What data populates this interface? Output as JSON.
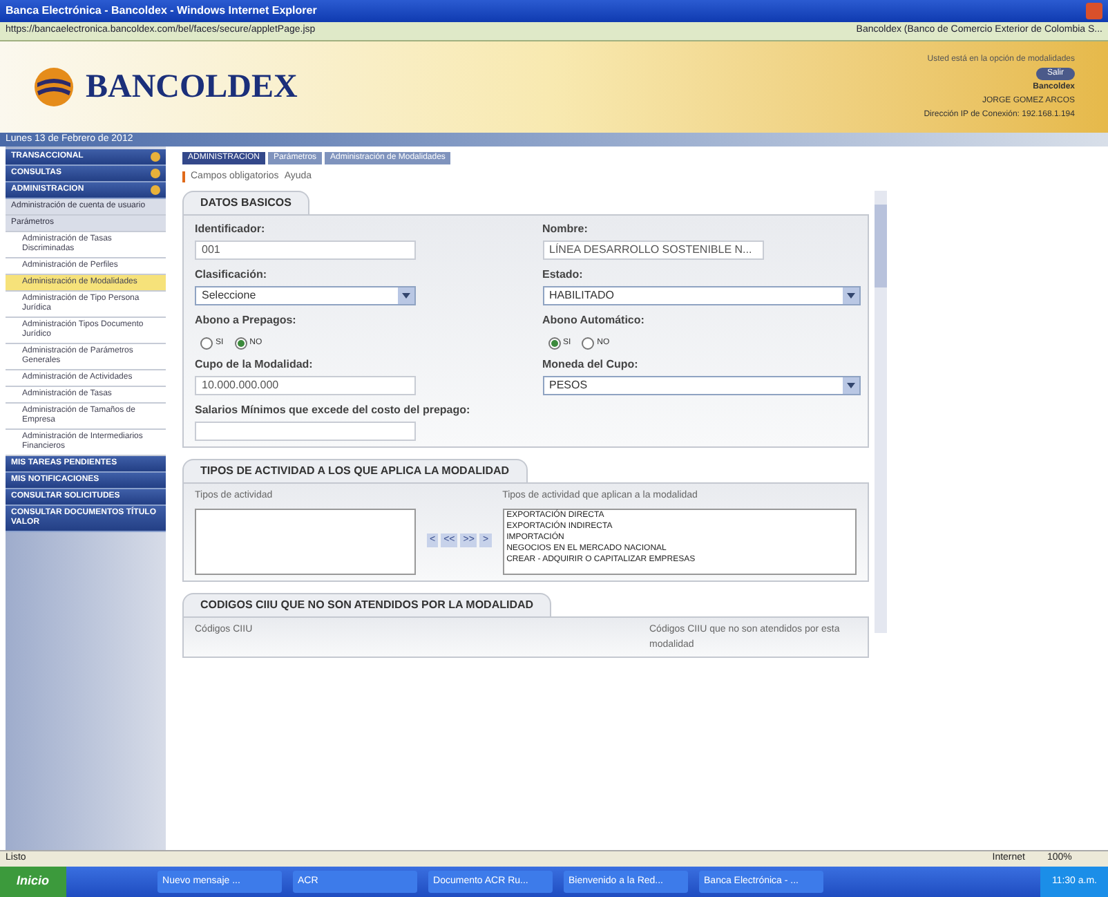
{
  "window": {
    "title": "Banca Electrónica - Bancoldex - Windows Internet Explorer"
  },
  "address_bar": {
    "url": "https://bancaelectronica.bancoldex.com/bel/faces/secure/appletPage.jsp",
    "tab": "Bancoldex (Banco de Comercio Exterior de Colombia S..."
  },
  "header": {
    "logo": "BANCOLDEX",
    "notice": "Usted está en la opción de modalidades",
    "logout": "Salir",
    "company": "Bancoldex",
    "user": "JORGE GOMEZ ARCOS",
    "ip": "Dirección IP de Conexión: 192.168.1.194",
    "date": "Lunes 13 de Febrero de 2012"
  },
  "sidebar": {
    "items": [
      {
        "label": "TRANSACCIONAL",
        "kind": "section"
      },
      {
        "label": "CONSULTAS",
        "kind": "section"
      },
      {
        "label": "ADMINISTRACION",
        "kind": "section",
        "children": [
          {
            "label": "Administración de cuenta de usuario",
            "kind": "group",
            "selected": false
          },
          {
            "label": "Parámetros",
            "kind": "group",
            "selected": false
          },
          {
            "label": "Administración de Tasas Discriminadas",
            "kind": "link",
            "selected": false
          },
          {
            "label": "Administración de Perfiles",
            "kind": "link",
            "selected": false
          },
          {
            "label": "Administración de Modalidades",
            "kind": "link",
            "selected": true
          },
          {
            "label": "Administración de Tipo Persona Jurídica",
            "kind": "link",
            "selected": false
          },
          {
            "label": "Administración Tipos Documento Jurídico",
            "kind": "link",
            "selected": false
          },
          {
            "label": "Administración de Parámetros Generales",
            "kind": "link",
            "selected": false
          },
          {
            "label": "Administración de Actividades",
            "kind": "link",
            "selected": false
          },
          {
            "label": "Administración de Tasas",
            "kind": "link",
            "selected": false
          },
          {
            "label": "Administración de Tamaños de Empresa",
            "kind": "link",
            "selected": false
          },
          {
            "label": "Administración de Intermediarios Financieros",
            "kind": "link",
            "selected": false
          }
        ]
      },
      {
        "label": "MIS TAREAS PENDIENTES",
        "kind": "plain"
      },
      {
        "label": "MIS NOTIFICACIONES",
        "kind": "plain"
      },
      {
        "label": "CONSULTAR SOLICITUDES",
        "kind": "plain"
      },
      {
        "label": "CONSULTAR DOCUMENTOS TÍTULO VALOR",
        "kind": "plain"
      }
    ]
  },
  "breadcrumb": [
    {
      "label": "ADMINISTRACION",
      "selected": true
    },
    {
      "label": "Parámetros",
      "selected": false
    },
    {
      "label": "Administración de Modalidades",
      "selected": false
    }
  ],
  "legend": {
    "required": "Campos obligatorios",
    "help": "Ayuda"
  },
  "basic": {
    "title": "DATOS BASICOS",
    "fields": [
      {
        "label": "Identificador:",
        "value": "001",
        "kind": "text"
      },
      {
        "label": "Nombre:",
        "value": "LÍNEA DESARROLLO SOSTENIBLE N...",
        "kind": "text"
      },
      {
        "label": "Clasificación:",
        "value": "Seleccione",
        "kind": "select"
      },
      {
        "label": "Estado:",
        "value": "HABILITADO",
        "kind": "select"
      },
      {
        "label": "Abono a Prepagos:",
        "kind": "radio",
        "options": [
          {
            "label": "SI",
            "selected": false
          },
          {
            "label": "NO",
            "selected": true
          }
        ]
      },
      {
        "label": "Abono Automático:",
        "kind": "radio",
        "options": [
          {
            "label": "SI",
            "selected": true
          },
          {
            "label": "NO",
            "selected": false
          }
        ]
      },
      {
        "label": "Cupo de la Modalidad:",
        "value": "10.000.000.000",
        "kind": "text"
      },
      {
        "label": "Moneda del Cupo:",
        "value": "PESOS",
        "kind": "select"
      },
      {
        "label": "Salarios Mínimos que excede del costo del prepago:",
        "kind": "text"
      }
    ]
  },
  "activities": {
    "title": "TIPOS DE ACTIVIDAD A LOS QUE APLICA LA MODALIDAD",
    "left_label": "Tipos de actividad",
    "right_label": "Tipos de actividad que aplican a la modalidad",
    "move_buttons": [
      "<",
      "<<",
      ">>",
      ">"
    ],
    "selected_items": [
      "EXPORTACIÓN DIRECTA",
      "EXPORTACIÓN INDIRECTA",
      "IMPORTACIÓN",
      "NEGOCIOS EN EL MERCADO NACIONAL",
      "CREAR - ADQUIRIR O CAPITALIZAR EMPRESAS"
    ]
  },
  "ciiu": {
    "title": "CODIGOS CIIU QUE NO SON ATENDIDOS POR LA MODALIDAD",
    "left_label": "Códigos CIIU",
    "right_label": "Códigos CIIU que no son atendidos por esta modalidad"
  },
  "status_bar": {
    "text": "Listo",
    "zone": "Internet",
    "zoom": "100%"
  },
  "taskbar": {
    "start": "Inicio",
    "tasks": [
      "Nuevo mensaje ...",
      "ACR",
      "Documento ACR Ru...",
      "Bienvenido a la Red...",
      "Banca Electrónica - ..."
    ],
    "clock": "11:30 a.m."
  }
}
